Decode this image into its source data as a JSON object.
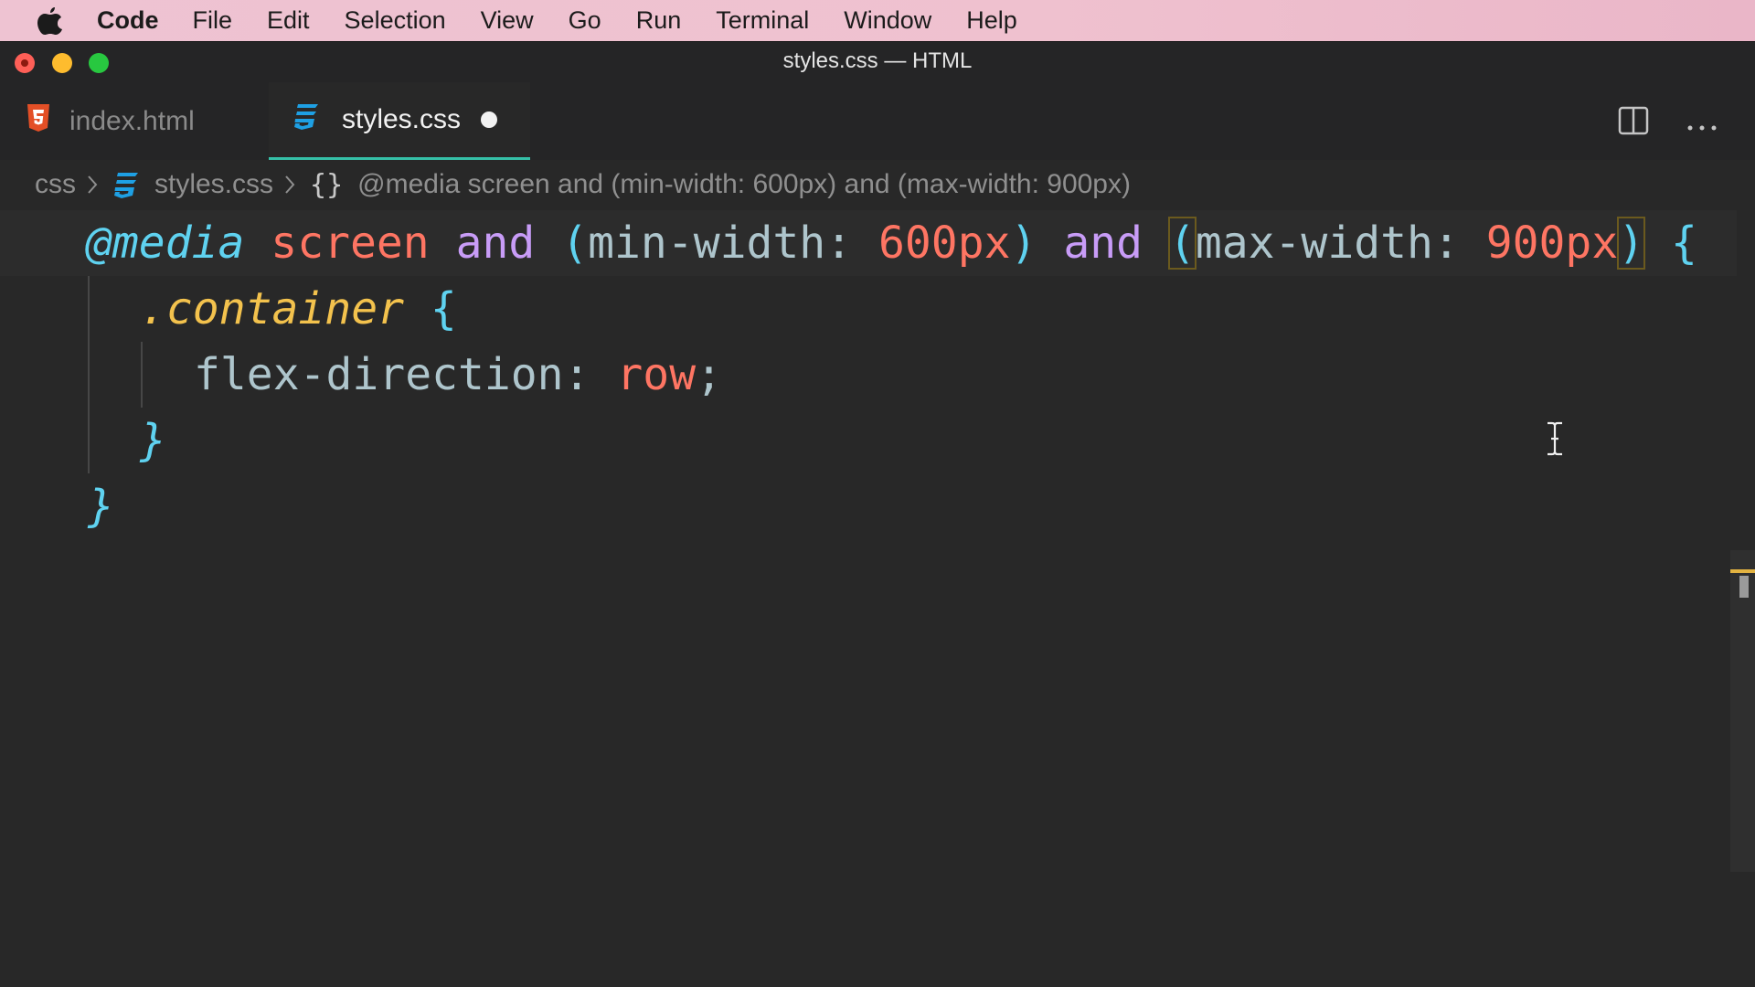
{
  "menubar": {
    "app_name": "Code",
    "items": [
      "File",
      "Edit",
      "Selection",
      "View",
      "Go",
      "Run",
      "Terminal",
      "Window",
      "Help"
    ]
  },
  "window": {
    "title": "styles.css — HTML"
  },
  "tabs": [
    {
      "label": "index.html",
      "icon": "html5-icon",
      "active": false
    },
    {
      "label": "styles.css",
      "icon": "css3-icon",
      "active": true,
      "unsaved": true
    }
  ],
  "breadcrumb": {
    "folder": "css",
    "file": "styles.css",
    "symbol_icon": "{}",
    "symbol": "@media screen and (min-width: 600px) and (max-width: 900px)"
  },
  "code": {
    "line1": {
      "at_rule": "@media",
      "media_type": "screen",
      "and1": "and",
      "open1": "(",
      "feature1": "min-width:",
      "value1": "600px",
      "close1": ")",
      "and2": "and",
      "open2": "(",
      "feature2": "max-width:",
      "value2": "900px",
      "close2": ")",
      "brace": "{"
    },
    "line2": {
      "selector": ".container",
      "brace": "{"
    },
    "line3": {
      "property": "flex-direction:",
      "value": "row",
      "semicolon": ";"
    },
    "line4": {
      "brace": "}"
    },
    "line5": {
      "brace": "}"
    }
  },
  "colors": {
    "accent_tab_underline": "#35c0a8",
    "editor_bg": "#282828",
    "keyword": "#5fd2f0",
    "string_value": "#fe7563",
    "operator": "#c89cf7",
    "selector": "#f3c24d"
  }
}
